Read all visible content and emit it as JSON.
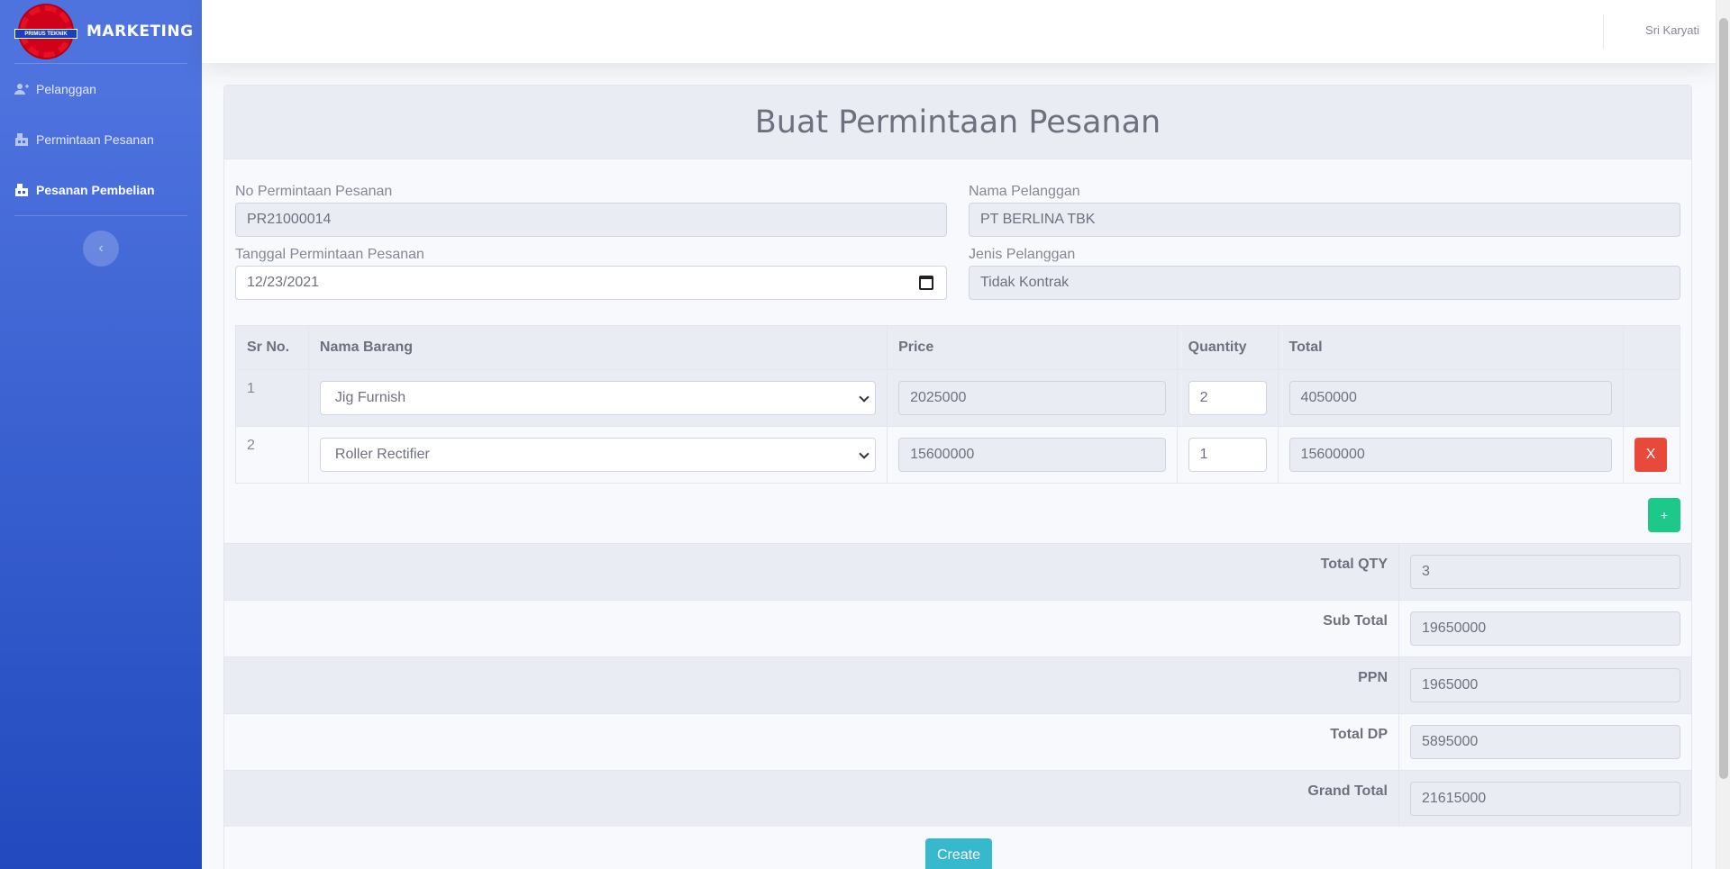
{
  "brand": {
    "name": "MARKETING",
    "logo_text": "PRIMUS TEKNIK"
  },
  "sidebar": {
    "items": [
      {
        "label": "Pelanggan",
        "icon": "user-plus-icon",
        "active": false
      },
      {
        "label": "Permintaan Pesanan",
        "icon": "warehouse-icon",
        "active": false
      },
      {
        "label": "Pesanan Pembelian",
        "icon": "warehouse-icon",
        "active": true
      }
    ],
    "toggle_icon": "chevron-left-icon"
  },
  "topbar": {
    "user_name": "Sri Karyati"
  },
  "page": {
    "title": "Buat Permintaan Pesanan"
  },
  "form": {
    "no_permintaan": {
      "label": "No Permintaan Pesanan",
      "value": "PR21000014"
    },
    "nama_pelanggan": {
      "label": "Nama Pelanggan",
      "value": "PT BERLINA TBK"
    },
    "tanggal": {
      "label": "Tanggal Permintaan Pesanan",
      "value": "12/23/2021"
    },
    "jenis_pelanggan": {
      "label": "Jenis Pelanggan",
      "value": "Tidak Kontrak"
    }
  },
  "table": {
    "headers": [
      "Sr No.",
      "Nama Barang",
      "Price",
      "Quantity",
      "Total",
      ""
    ],
    "rows": [
      {
        "sr": "1",
        "item": "Jig Furnish",
        "price": "2025000",
        "qty": "2",
        "total": "4050000"
      },
      {
        "sr": "2",
        "item": "Roller Rectifier",
        "price": "15600000",
        "qty": "1",
        "total": "15600000",
        "remove_label": "X"
      }
    ],
    "add_label": "+"
  },
  "summary": {
    "total_qty": {
      "label": "Total QTY",
      "value": "3"
    },
    "sub_total": {
      "label": "Sub Total",
      "value": "19650000"
    },
    "ppn": {
      "label": "PPN",
      "value": "1965000"
    },
    "total_dp": {
      "label": "Total DP",
      "value": "5895000"
    },
    "grand_total": {
      "label": "Grand Total",
      "value": "21615000"
    }
  },
  "actions": {
    "create_label": "Create"
  },
  "colors": {
    "primary": "#4e73df",
    "danger": "#e74a3b",
    "success": "#1cc88a",
    "info": "#36b9cc"
  }
}
